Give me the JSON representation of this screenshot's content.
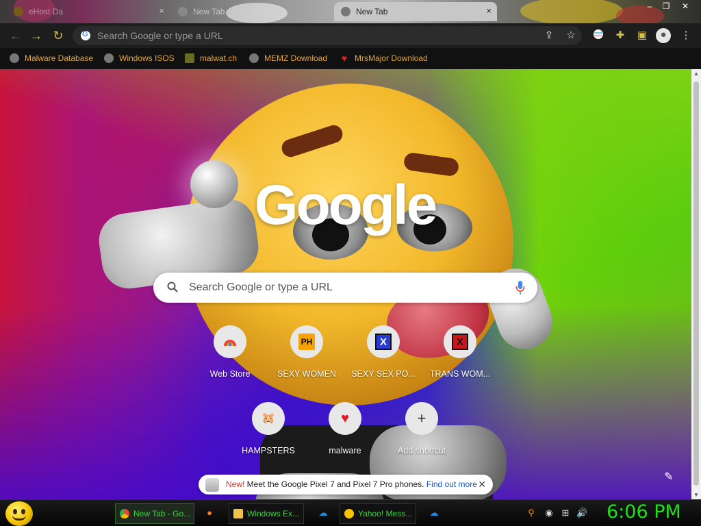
{
  "browser": {
    "tabs": [
      {
        "label": "eHost Da",
        "active": false
      },
      {
        "label": "New Tab",
        "active": false
      },
      {
        "label": "New Tab",
        "active": true
      }
    ],
    "tab_close_glyph": "×",
    "window_controls": [
      "–",
      "❐",
      "✕"
    ],
    "omnibox": {
      "placeholder": "Search Google or type a URL"
    },
    "toolbar_icons": [
      "back-icon",
      "forward-icon",
      "reload-icon",
      "share-icon",
      "star-icon",
      "extension-flag-icon",
      "puzzle-icon",
      "sidepanel-icon",
      "profile-icon",
      "menu-icon"
    ]
  },
  "bookmarks": [
    {
      "label": "Malware Database",
      "icon": "globe-icon"
    },
    {
      "label": "Windows ISOS",
      "icon": "globe-icon"
    },
    {
      "label": "malwat.ch",
      "icon": "person-icon"
    },
    {
      "label": "MEMZ Download",
      "icon": "globe-icon"
    },
    {
      "label": "MrsMajor Download",
      "icon": "heart-icon"
    }
  ],
  "ntp": {
    "logo": "Google",
    "search_placeholder": "Search Google or type a URL",
    "shortcuts": [
      {
        "label": "Web Store",
        "glyph": "◔"
      },
      {
        "label": "SEXY WOMEN",
        "glyph": "PH"
      },
      {
        "label": "SEXY SEX PO...",
        "glyph": "X"
      },
      {
        "label": "TRANS WOM...",
        "glyph": "X"
      },
      {
        "label": "HAMPSTERS",
        "glyph": "🐹"
      },
      {
        "label": "malware",
        "glyph": "♥"
      },
      {
        "label": "Add shortcut",
        "glyph": "+"
      }
    ],
    "promo": {
      "new": "New!",
      "text": " Meet the Google Pixel 7 and Pixel 7 Pro phones. ",
      "link": "Find out more",
      "close": "✕"
    },
    "edit_glyph": "✎"
  },
  "taskbar": {
    "buttons": [
      {
        "label": "New Tab - Go...",
        "icon": "chrome-icon"
      },
      {
        "label": "Windows Ex...",
        "icon": "folder-icon"
      },
      {
        "label": "Yahoo! Mess...",
        "icon": "yahoo-smiley-icon"
      }
    ],
    "clock": "6:06 PM"
  },
  "colors": {
    "bookmark_text": "#e6a53a",
    "taskbar_text": "#3ad43a",
    "clock": "#1ee01e"
  }
}
